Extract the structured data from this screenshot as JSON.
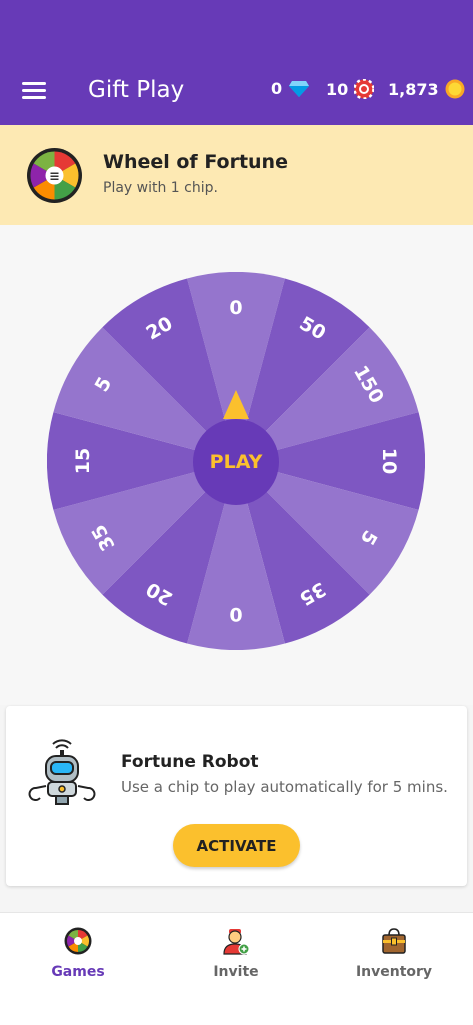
{
  "header": {
    "title": "Gift Play",
    "gems": "0",
    "chips": "10",
    "coins": "1,873",
    "color": "#673ab7"
  },
  "banner": {
    "title": "Wheel of Fortune",
    "subtitle": "Play with 1 chip.",
    "icon": "wheel-icon"
  },
  "wheel": {
    "play_label": "PLAY",
    "segments": [
      "0",
      "50",
      "150",
      "10",
      "5",
      "35",
      "0",
      "20",
      "35",
      "15",
      "5",
      "20"
    ]
  },
  "robot": {
    "title": "Fortune Robot",
    "subtitle": "Use a chip to play automatically for 5 mins.",
    "button_label": "ACTIVATE",
    "icon": "robot-icon"
  },
  "nav": {
    "items": [
      {
        "label": "Games",
        "icon": "wheel-icon",
        "active": true
      },
      {
        "label": "Invite",
        "icon": "person-add-icon",
        "active": false
      },
      {
        "label": "Inventory",
        "icon": "chest-icon",
        "active": false
      }
    ]
  }
}
